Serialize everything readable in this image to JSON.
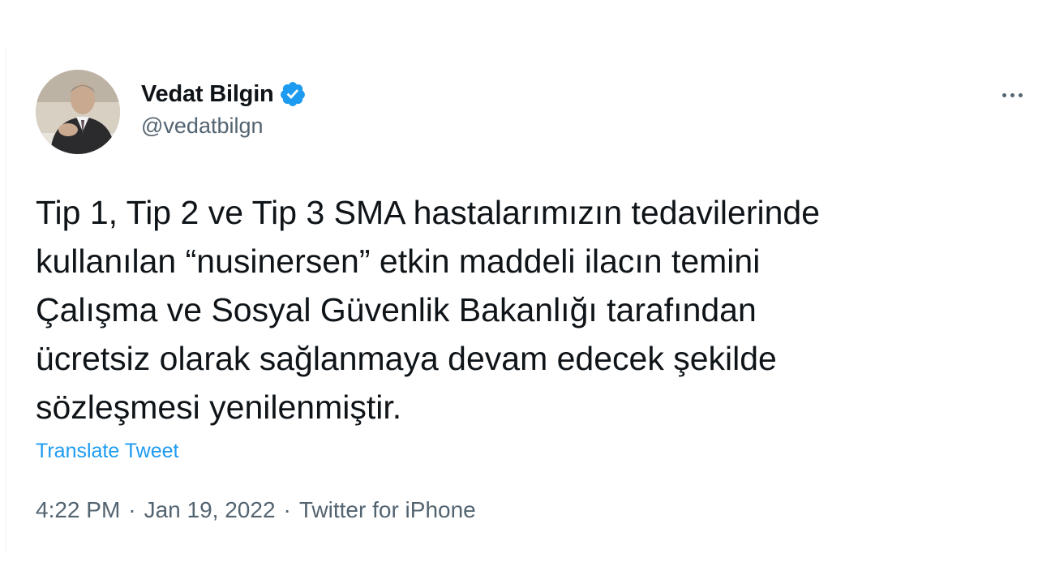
{
  "author": {
    "display_name": "Vedat Bilgin",
    "handle": "@vedatbilgn",
    "verified": true
  },
  "tweet": {
    "lines": [
      "Tip 1, Tip 2 ve Tip 3 SMA hastalarımızın tedavilerinde",
      "kullanılan “nusinersen” etkin maddeli ilacın temini",
      "Çalışma ve Sosyal Güvenlik Bakanlığı tarafından",
      "ücretsiz olarak sağlanmaya devam edecek şekilde",
      "sözleşmesi yenilenmiştir."
    ],
    "translate_label": "Translate Tweet",
    "time": "4:22 PM",
    "separator": "·",
    "date": "Jan 19, 2022",
    "source": "Twitter for iPhone"
  },
  "icons": {
    "verified": "verified-badge-icon",
    "more": "more-options-icon"
  },
  "colors": {
    "accent": "#1d9bf0",
    "secondary_text": "#536471",
    "primary_text": "#0f1419"
  }
}
